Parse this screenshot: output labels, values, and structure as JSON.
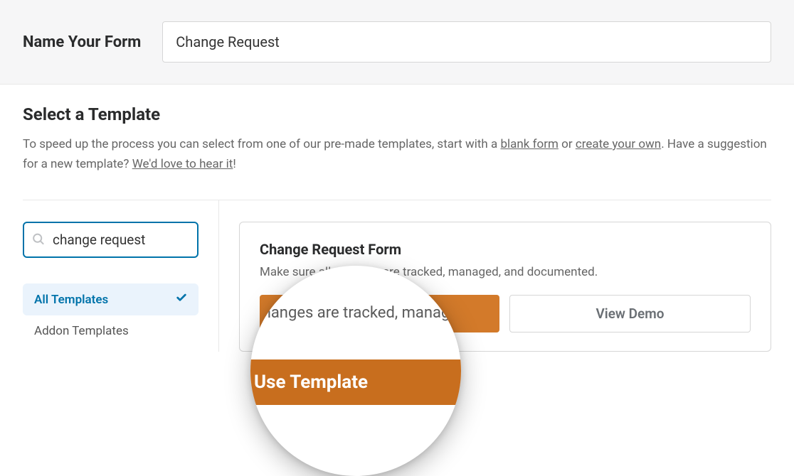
{
  "header": {
    "label": "Name Your Form",
    "form_name_value": "Change Request"
  },
  "select_template": {
    "title": "Select a Template",
    "description_prefix": "To speed up the process you can select from one of our pre-made templates, start with a ",
    "link_blank": "blank form",
    "middle_text": " or ",
    "link_create": "create your own",
    "after_create": ". Have a suggestion for a new template? ",
    "link_hear": "We'd love to hear it",
    "exclaim": "!"
  },
  "search": {
    "value": "change request"
  },
  "categories": [
    {
      "label": "All Templates",
      "active": true
    },
    {
      "label": "Addon Templates",
      "active": false
    }
  ],
  "template_card": {
    "title": "Change Request Form",
    "description": "Make sure all changes are tracked, managed, and documented.",
    "use_label": "Use Template",
    "demo_label": "View Demo"
  },
  "magnify": {
    "description_fragment": "Make sure all changes are tracked, managed, and documented.",
    "button_label": "Use Template"
  }
}
